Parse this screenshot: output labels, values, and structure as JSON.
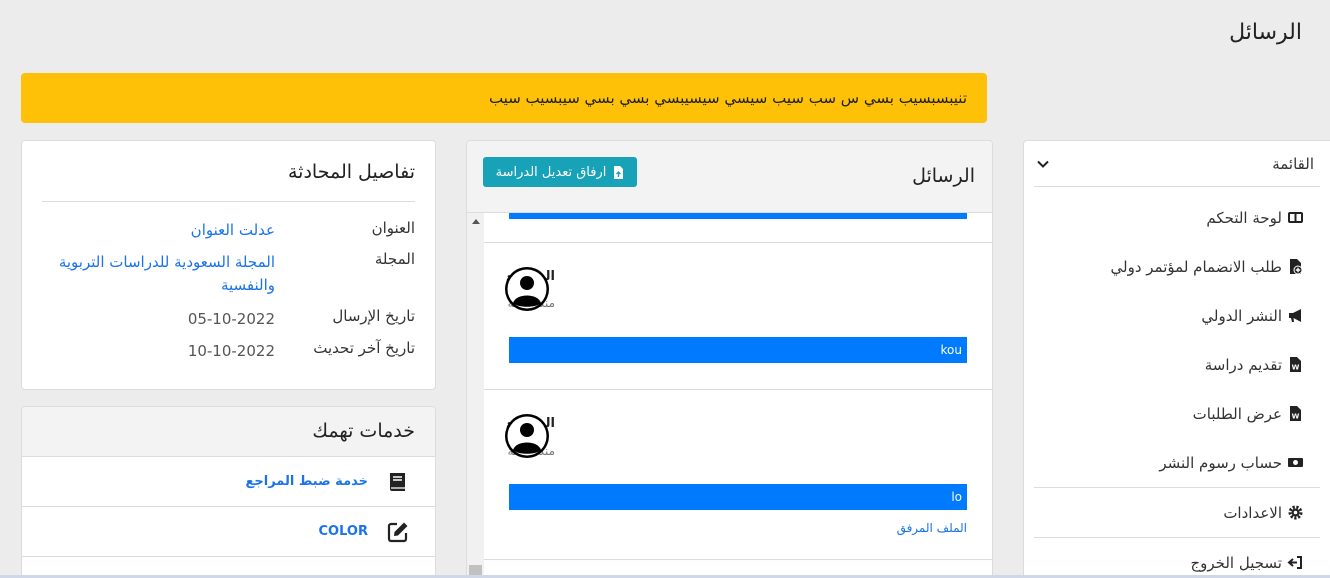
{
  "page": {
    "title": "الرسائل"
  },
  "alert": {
    "text": "تنيبسبسيب بسي س سب سيب سيسي سيسيبسي بسي بسي سيبسيب سيب"
  },
  "sidebar": {
    "header": "القائمة",
    "items": [
      {
        "label": "لوحة التحكم",
        "icon": "dashboard-icon"
      },
      {
        "label": "طلب الانضمام لمؤتمر دولي",
        "icon": "file-plus-icon"
      },
      {
        "label": "النشر الدولي",
        "icon": "megaphone-icon"
      },
      {
        "label": "تقديم دراسة",
        "icon": "word-file-icon"
      },
      {
        "label": "عرض الطلبات",
        "icon": "word-file-icon"
      },
      {
        "label": "حساب رسوم النشر",
        "icon": "money-icon"
      }
    ],
    "settings_label": "الاعدادات",
    "logout_label": "تسجيل الخروج"
  },
  "messages": {
    "title": "الرسائل",
    "attach_button": "ارفاق تعديل الدراسة",
    "items": [
      {
        "author": "المراجع",
        "time": "منذ ساعة",
        "text": "kou"
      },
      {
        "author": "المراجع",
        "time": "منذ ساعة",
        "text": "lo",
        "attachment": "الملف المرفق"
      }
    ]
  },
  "details": {
    "title": "تفاصيل المحادثة",
    "rows": [
      {
        "label": "العنوان",
        "value": "عدلت العنوان"
      },
      {
        "label": "المجلة",
        "value_line1": "المجلة السعودية للدراسات التربوية",
        "value_line2": "والنفسية"
      },
      {
        "label": "تاريخ الإرسال",
        "value": "05-10-2022"
      },
      {
        "label": "تاريخ آخر تحديث",
        "value": "10-10-2022"
      }
    ]
  },
  "services": {
    "title": "خدمات تهمك",
    "items": [
      {
        "label": "خدمة ضبط المراجع",
        "icon": "book-icon"
      },
      {
        "label": "COLOR",
        "icon": "edit-icon"
      }
    ]
  },
  "colors": {
    "alert": "#fec107",
    "primary": "#007bff",
    "info": "#17a2b8",
    "link": "#1a73e8"
  }
}
